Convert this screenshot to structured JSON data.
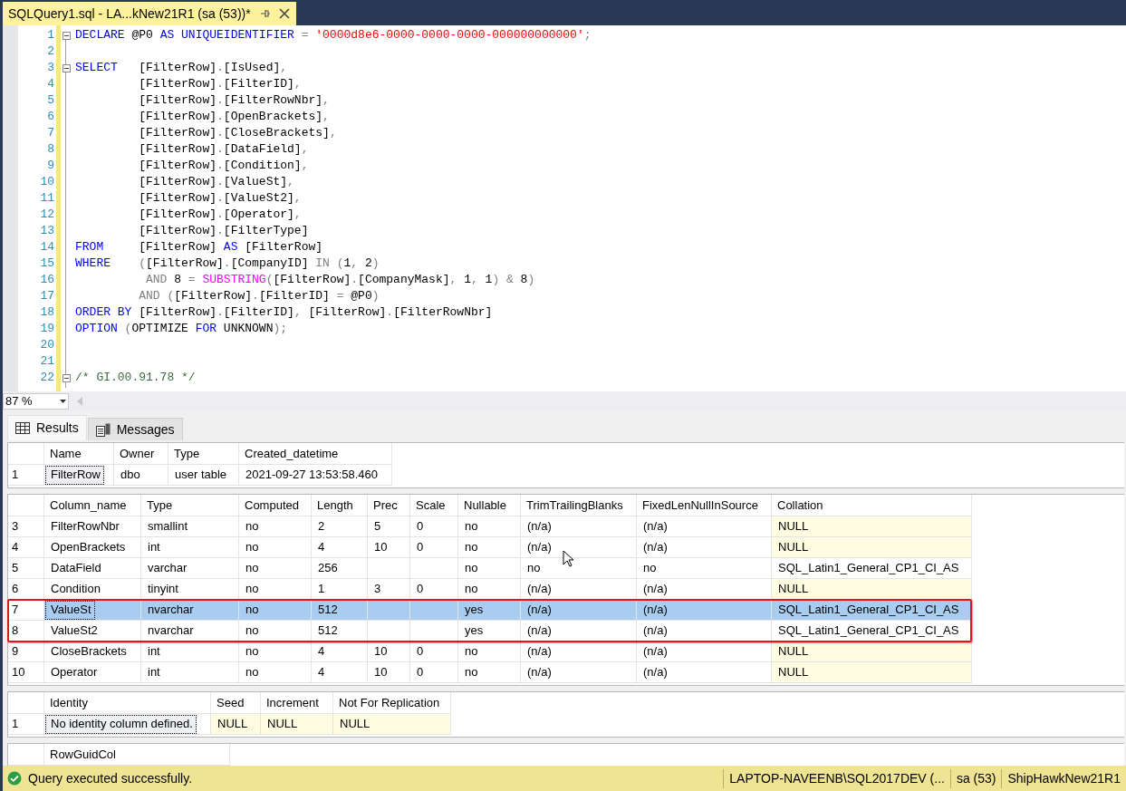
{
  "document_tab": {
    "title": "SQLQuery1.sql - LA...kNew21R1 (sa (53))*",
    "selected": true
  },
  "editor": {
    "lines": [
      {
        "number": "1",
        "fold_marker": true,
        "tokens": [
          {
            "kind": "keyword",
            "text": "DECLARE"
          },
          {
            "kind": "plain",
            "text": " @P0 "
          },
          {
            "kind": "keyword",
            "text": "AS"
          },
          {
            "kind": "keyword",
            "text": " UNIQUEIDENTIFIER"
          },
          {
            "kind": "operator",
            "text": " ="
          },
          {
            "kind": "string",
            "text": " '0000d8e6-0000-0000-0000-000000000000'"
          },
          {
            "kind": "operator",
            "text": ";"
          }
        ]
      },
      {
        "number": "2",
        "fold_marker": false
      },
      {
        "number": "3",
        "fold_marker": true,
        "tokens": [
          {
            "kind": "keyword",
            "text": "SELECT"
          },
          {
            "kind": "plain",
            "text": "   [FilterRow]"
          },
          {
            "kind": "operator",
            "text": "."
          },
          {
            "kind": "plain",
            "text": "[IsUsed]"
          },
          {
            "kind": "operator",
            "text": ","
          }
        ]
      },
      {
        "number": "4",
        "fold_marker": false,
        "tokens": [
          {
            "kind": "plain",
            "text": "         [FilterRow]"
          },
          {
            "kind": "operator",
            "text": "."
          },
          {
            "kind": "plain",
            "text": "[FilterID]"
          },
          {
            "kind": "operator",
            "text": ","
          }
        ]
      },
      {
        "number": "5",
        "fold_marker": false,
        "tokens": [
          {
            "kind": "plain",
            "text": "         [FilterRow]"
          },
          {
            "kind": "operator",
            "text": "."
          },
          {
            "kind": "plain",
            "text": "[FilterRowNbr]"
          },
          {
            "kind": "operator",
            "text": ","
          }
        ]
      },
      {
        "number": "6",
        "fold_marker": false,
        "tokens": [
          {
            "kind": "plain",
            "text": "         [FilterRow]"
          },
          {
            "kind": "operator",
            "text": "."
          },
          {
            "kind": "plain",
            "text": "[OpenBrackets]"
          },
          {
            "kind": "operator",
            "text": ","
          }
        ]
      },
      {
        "number": "7",
        "fold_marker": false,
        "tokens": [
          {
            "kind": "plain",
            "text": "         [FilterRow]"
          },
          {
            "kind": "operator",
            "text": "."
          },
          {
            "kind": "plain",
            "text": "[CloseBrackets]"
          },
          {
            "kind": "operator",
            "text": ","
          }
        ]
      },
      {
        "number": "8",
        "fold_marker": false,
        "tokens": [
          {
            "kind": "plain",
            "text": "         [FilterRow]"
          },
          {
            "kind": "operator",
            "text": "."
          },
          {
            "kind": "plain",
            "text": "[DataField]"
          },
          {
            "kind": "operator",
            "text": ","
          }
        ]
      },
      {
        "number": "9",
        "fold_marker": false,
        "tokens": [
          {
            "kind": "plain",
            "text": "         [FilterRow]"
          },
          {
            "kind": "operator",
            "text": "."
          },
          {
            "kind": "plain",
            "text": "[Condition]"
          },
          {
            "kind": "operator",
            "text": ","
          }
        ]
      },
      {
        "number": "10",
        "fold_marker": false,
        "tokens": [
          {
            "kind": "plain",
            "text": "         [FilterRow]"
          },
          {
            "kind": "operator",
            "text": "."
          },
          {
            "kind": "plain",
            "text": "[ValueSt]"
          },
          {
            "kind": "operator",
            "text": ","
          }
        ]
      },
      {
        "number": "11",
        "fold_marker": false,
        "tokens": [
          {
            "kind": "plain",
            "text": "         [FilterRow]"
          },
          {
            "kind": "operator",
            "text": "."
          },
          {
            "kind": "plain",
            "text": "[ValueSt2]"
          },
          {
            "kind": "operator",
            "text": ","
          }
        ]
      },
      {
        "number": "12",
        "fold_marker": false,
        "tokens": [
          {
            "kind": "plain",
            "text": "         [FilterRow]"
          },
          {
            "kind": "operator",
            "text": "."
          },
          {
            "kind": "plain",
            "text": "[Operator]"
          },
          {
            "kind": "operator",
            "text": ","
          }
        ]
      },
      {
        "number": "13",
        "fold_marker": false,
        "tokens": [
          {
            "kind": "plain",
            "text": "         [FilterRow]"
          },
          {
            "kind": "operator",
            "text": "."
          },
          {
            "kind": "plain",
            "text": "[FilterType]"
          }
        ]
      },
      {
        "number": "14",
        "fold_marker": false,
        "tokens": [
          {
            "kind": "keyword",
            "text": "FROM"
          },
          {
            "kind": "plain",
            "text": "     [FilterRow] "
          },
          {
            "kind": "keyword",
            "text": "AS"
          },
          {
            "kind": "plain",
            "text": " [FilterRow]"
          }
        ]
      },
      {
        "number": "15",
        "fold_marker": false,
        "tokens": [
          {
            "kind": "keyword",
            "text": "WHERE"
          },
          {
            "kind": "operator",
            "text": "    ("
          },
          {
            "kind": "plain",
            "text": "[FilterRow]"
          },
          {
            "kind": "operator",
            "text": "."
          },
          {
            "kind": "plain",
            "text": "[CompanyID] "
          },
          {
            "kind": "operator",
            "text": "IN"
          },
          {
            "kind": "operator",
            "text": " ("
          },
          {
            "kind": "plain",
            "text": "1"
          },
          {
            "kind": "operator",
            "text": ", "
          },
          {
            "kind": "plain",
            "text": "2"
          },
          {
            "kind": "operator",
            "text": ")"
          }
        ]
      },
      {
        "number": "16",
        "fold_marker": false,
        "tokens": [
          {
            "kind": "operator",
            "text": "          AND"
          },
          {
            "kind": "plain",
            "text": " 8 "
          },
          {
            "kind": "operator",
            "text": "="
          },
          {
            "kind": "function",
            "text": " SUBSTRING"
          },
          {
            "kind": "operator",
            "text": "("
          },
          {
            "kind": "plain",
            "text": "[FilterRow]"
          },
          {
            "kind": "operator",
            "text": "."
          },
          {
            "kind": "plain",
            "text": "[CompanyMask]"
          },
          {
            "kind": "operator",
            "text": ","
          },
          {
            "kind": "plain",
            "text": " 1"
          },
          {
            "kind": "operator",
            "text": ","
          },
          {
            "kind": "plain",
            "text": " 1"
          },
          {
            "kind": "operator",
            "text": ")"
          },
          {
            "kind": "operator",
            "text": " &"
          },
          {
            "kind": "plain",
            "text": " 8"
          },
          {
            "kind": "operator",
            "text": ")"
          }
        ]
      },
      {
        "number": "17",
        "fold_marker": false,
        "tokens": [
          {
            "kind": "operator",
            "text": "         AND"
          },
          {
            "kind": "operator",
            "text": " ("
          },
          {
            "kind": "plain",
            "text": "[FilterRow]"
          },
          {
            "kind": "operator",
            "text": "."
          },
          {
            "kind": "plain",
            "text": "[FilterID] "
          },
          {
            "kind": "operator",
            "text": "="
          },
          {
            "kind": "plain",
            "text": " @P0"
          },
          {
            "kind": "operator",
            "text": ")"
          }
        ]
      },
      {
        "number": "18",
        "fold_marker": false,
        "tokens": [
          {
            "kind": "keyword",
            "text": "ORDER BY"
          },
          {
            "kind": "plain",
            "text": " [FilterRow]"
          },
          {
            "kind": "operator",
            "text": "."
          },
          {
            "kind": "plain",
            "text": "[FilterID]"
          },
          {
            "kind": "operator",
            "text": ","
          },
          {
            "kind": "plain",
            "text": " [FilterRow]"
          },
          {
            "kind": "operator",
            "text": "."
          },
          {
            "kind": "plain",
            "text": "[FilterRowNbr]"
          }
        ]
      },
      {
        "number": "19",
        "fold_marker": false,
        "tokens": [
          {
            "kind": "keyword",
            "text": "OPTION"
          },
          {
            "kind": "operator",
            "text": " ("
          },
          {
            "kind": "plain",
            "text": "OPTIMIZE "
          },
          {
            "kind": "keyword",
            "text": "FOR"
          },
          {
            "kind": "plain",
            "text": " UNKNOWN"
          },
          {
            "kind": "operator",
            "text": ");"
          }
        ]
      },
      {
        "number": "20",
        "fold_marker": false
      },
      {
        "number": "21",
        "fold_marker": false
      },
      {
        "number": "22",
        "fold_marker": true,
        "tokens": [
          {
            "kind": "comment",
            "text": "/* GI.00.91.78 */"
          }
        ]
      }
    ]
  },
  "zoom": {
    "value": "87 %"
  },
  "result_tabs": [
    {
      "label": "Results",
      "selected": true
    },
    {
      "label": "Messages",
      "selected": false
    }
  ],
  "result_grids": [
    {
      "columns": [
        "Name",
        "Owner",
        "Type",
        "Created_datetime"
      ],
      "rows": [
        {
          "row_number": "1",
          "selected": false,
          "outlined": false,
          "cells": [
            {
              "text": "FilterRow",
              "focused": true
            },
            "dbo",
            "user table",
            "2021-09-27 13:53:58.460"
          ]
        }
      ]
    },
    {
      "columns": [
        "Column_name",
        "Type",
        "Computed",
        "Length",
        "Prec",
        "Scale",
        "Nullable",
        "TrimTrailingBlanks",
        "FixedLenNullInSource",
        "Collation"
      ],
      "rows": [
        {
          "row_number": "3",
          "selected": false,
          "outlined": false,
          "cells": [
            "FilterRowNbr",
            "smallint",
            "no",
            "2",
            "5",
            "0",
            "no",
            "(n/a)",
            "(n/a)",
            {
              "text": "NULL",
              "null": true
            }
          ]
        },
        {
          "row_number": "4",
          "selected": false,
          "outlined": false,
          "cells": [
            "OpenBrackets",
            "int",
            "no",
            "4",
            "10",
            "0",
            "no",
            "(n/a)",
            "(n/a)",
            {
              "text": "NULL",
              "null": true
            }
          ]
        },
        {
          "row_number": "5",
          "selected": false,
          "outlined": false,
          "cells": [
            "DataField",
            "varchar",
            "no",
            "256",
            null,
            null,
            "no",
            "no",
            "no",
            "SQL_Latin1_General_CP1_CI_AS"
          ]
        },
        {
          "row_number": "6",
          "selected": false,
          "outlined": false,
          "cells": [
            "Condition",
            "tinyint",
            "no",
            "1",
            "3",
            "0",
            "no",
            "(n/a)",
            "(n/a)",
            {
              "text": "NULL",
              "null": true
            }
          ]
        },
        {
          "row_number": "7",
          "selected": true,
          "outlined": true,
          "cells": [
            {
              "text": "ValueSt",
              "focused": true
            },
            "nvarchar",
            "no",
            "512",
            null,
            null,
            "yes",
            "(n/a)",
            "(n/a)",
            "SQL_Latin1_General_CP1_CI_AS"
          ]
        },
        {
          "row_number": "8",
          "selected": false,
          "outlined": true,
          "cells": [
            "ValueSt2",
            "nvarchar",
            "no",
            "512",
            null,
            null,
            "yes",
            "(n/a)",
            "(n/a)",
            "SQL_Latin1_General_CP1_CI_AS"
          ]
        },
        {
          "row_number": "9",
          "selected": false,
          "outlined": false,
          "cells": [
            "CloseBrackets",
            "int",
            "no",
            "4",
            "10",
            "0",
            "no",
            "(n/a)",
            "(n/a)",
            {
              "text": "NULL",
              "null": true
            }
          ]
        },
        {
          "row_number": "10",
          "selected": false,
          "outlined": false,
          "cells": [
            "Operator",
            "int",
            "no",
            "4",
            "10",
            "0",
            "no",
            "(n/a)",
            "(n/a)",
            {
              "text": "NULL",
              "null": true
            }
          ]
        }
      ]
    },
    {
      "columns": [
        "Identity",
        "Seed",
        "Increment",
        "Not For Replication"
      ],
      "rows": [
        {
          "row_number": "1",
          "selected": false,
          "outlined": false,
          "cells": [
            {
              "text": "No identity column defined.",
              "focused": true
            },
            {
              "text": "NULL",
              "null": true
            },
            {
              "text": "NULL",
              "null": true
            },
            {
              "text": "NULL",
              "null": true
            }
          ]
        }
      ]
    },
    {
      "columns": [
        "RowGuidCol"
      ]
    }
  ],
  "status_bar": {
    "message": "Query executed successfully.",
    "server": "LAPTOP-NAVEENB\\SQL2017DEV (...",
    "login": "sa (53)",
    "database": "ShipHawkNew21R1"
  }
}
